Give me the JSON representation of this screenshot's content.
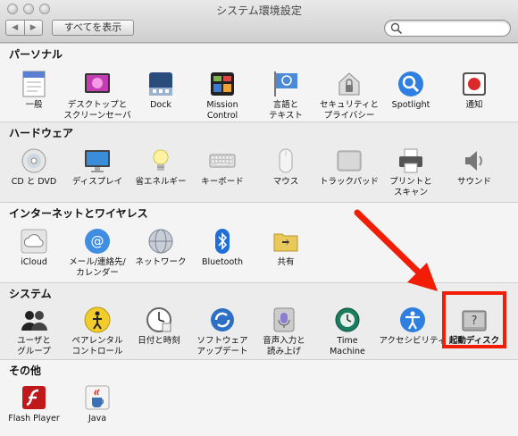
{
  "window": {
    "title": "システム環境設定"
  },
  "toolbar": {
    "back": "◀",
    "forward": "▶",
    "show_all": "すべてを表示",
    "search_value": ""
  },
  "sections": [
    {
      "title": "パーソナル",
      "items": [
        {
          "label": "一般",
          "icon": "general-icon"
        },
        {
          "label": "デスクトップと\nスクリーンセーバ",
          "icon": "desktop-screensaver-icon"
        },
        {
          "label": "Dock",
          "icon": "dock-icon"
        },
        {
          "label": "Mission\nControl",
          "icon": "mission-control-icon"
        },
        {
          "label": "言語と\nテキスト",
          "icon": "language-text-icon"
        },
        {
          "label": "セキュリティと\nプライバシー",
          "icon": "security-icon"
        },
        {
          "label": "Spotlight",
          "icon": "spotlight-icon"
        },
        {
          "label": "通知",
          "icon": "notifications-icon"
        }
      ]
    },
    {
      "title": "ハードウェア",
      "items": [
        {
          "label": "CD と DVD",
          "icon": "cd-dvd-icon"
        },
        {
          "label": "ディスプレイ",
          "icon": "display-icon"
        },
        {
          "label": "省エネルギー",
          "icon": "energy-saver-icon"
        },
        {
          "label": "キーボード",
          "icon": "keyboard-icon"
        },
        {
          "label": "マウス",
          "icon": "mouse-icon"
        },
        {
          "label": "トラックパッド",
          "icon": "trackpad-icon"
        },
        {
          "label": "プリントと\nスキャン",
          "icon": "printer-icon"
        },
        {
          "label": "サウンド",
          "icon": "sound-icon"
        }
      ]
    },
    {
      "title": "インターネットとワイヤレス",
      "items": [
        {
          "label": "iCloud",
          "icon": "icloud-icon"
        },
        {
          "label": "メール/連絡先/\nカレンダー",
          "icon": "mail-contacts-icon"
        },
        {
          "label": "ネットワーク",
          "icon": "network-icon"
        },
        {
          "label": "Bluetooth",
          "icon": "bluetooth-icon"
        },
        {
          "label": "共有",
          "icon": "sharing-icon"
        }
      ]
    },
    {
      "title": "システム",
      "items": [
        {
          "label": "ユーザと\nグループ",
          "icon": "users-groups-icon"
        },
        {
          "label": "ペアレンタル\nコントロール",
          "icon": "parental-controls-icon"
        },
        {
          "label": "日付と時刻",
          "icon": "date-time-icon"
        },
        {
          "label": "ソフトウェア\nアップデート",
          "icon": "software-update-icon"
        },
        {
          "label": "音声入力と\n読み上げ",
          "icon": "dictation-speech-icon"
        },
        {
          "label": "Time\nMachine",
          "icon": "time-machine-icon"
        },
        {
          "label": "アクセシビリティ",
          "icon": "accessibility-icon"
        },
        {
          "label": "起動ディスク",
          "icon": "startup-disk-icon"
        }
      ]
    },
    {
      "title": "その他",
      "items": [
        {
          "label": "Flash Player",
          "icon": "flash-player-icon"
        },
        {
          "label": "Java",
          "icon": "java-icon"
        }
      ]
    }
  ],
  "annotation": {
    "color": "#f21d05",
    "target": "起動ディスク"
  }
}
